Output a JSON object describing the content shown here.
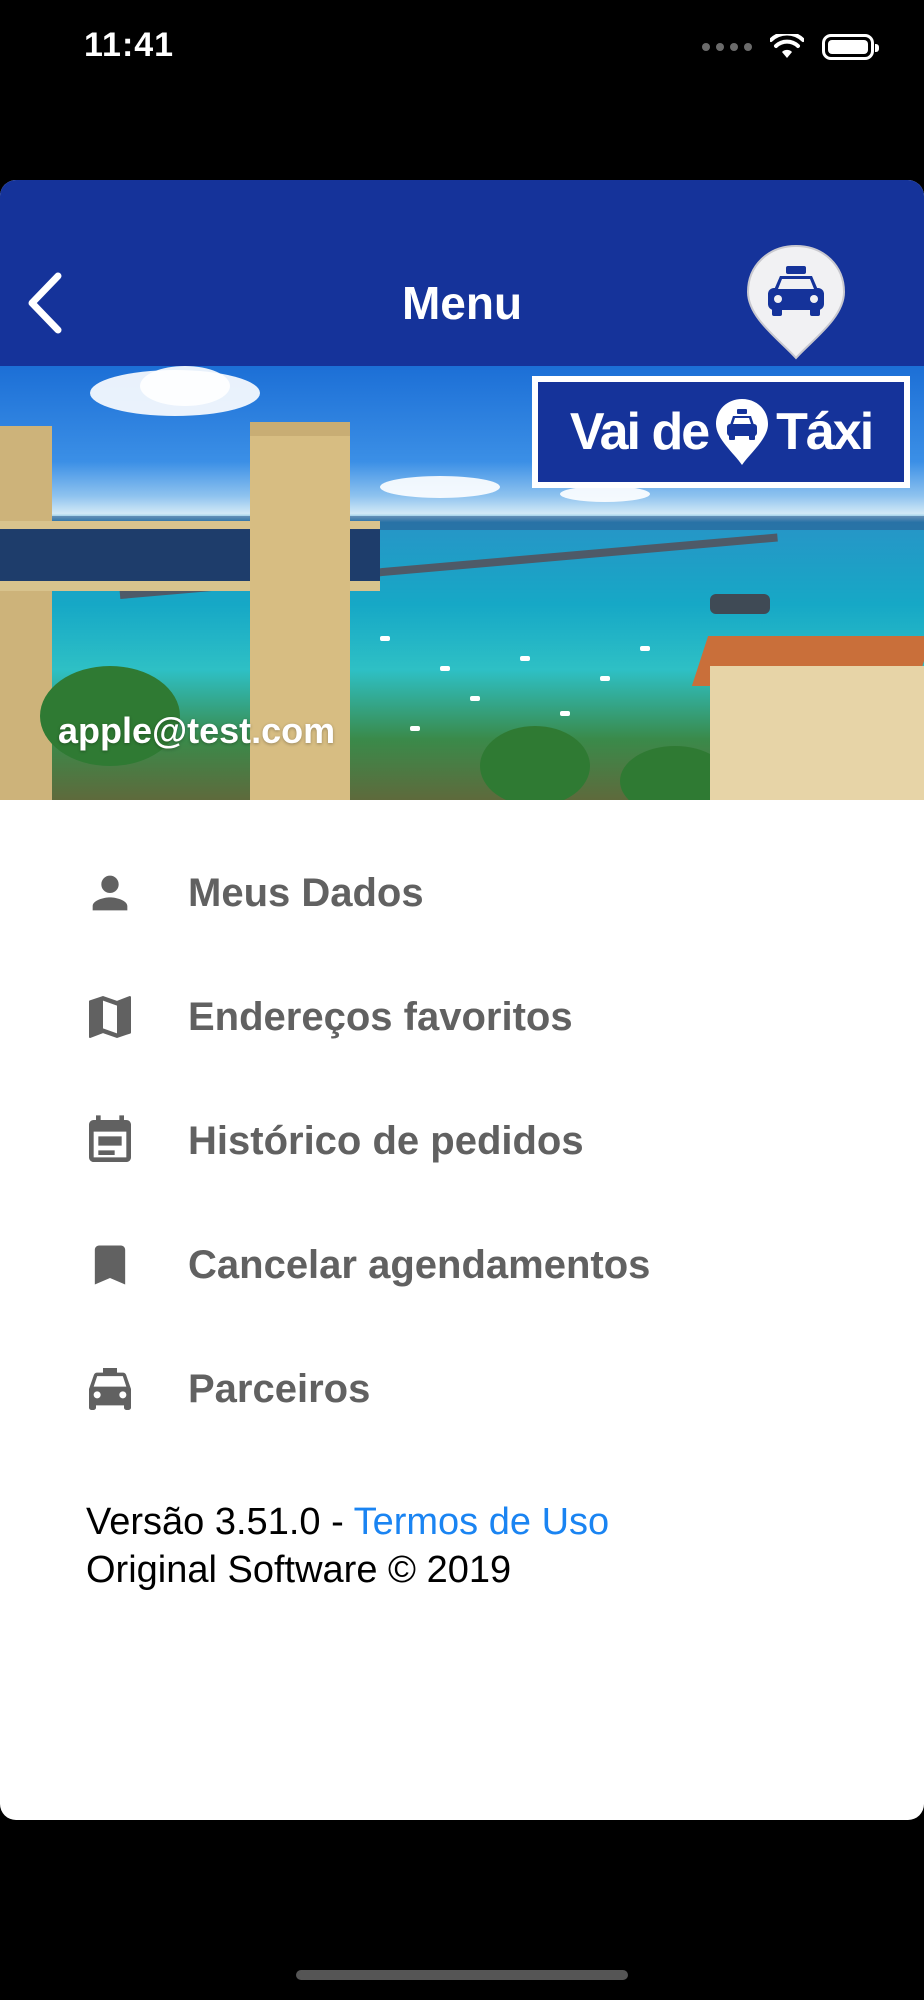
{
  "status_bar": {
    "time": "11:41"
  },
  "header": {
    "title": "Menu"
  },
  "banner": {
    "logo_text_left": "Vai de",
    "logo_text_right": "Táxi",
    "email": "apple@test.com"
  },
  "menu": {
    "items": [
      {
        "label": "Meus Dados",
        "icon": "person-icon"
      },
      {
        "label": "Endereços favoritos",
        "icon": "map-icon"
      },
      {
        "label": "Histórico de pedidos",
        "icon": "calendar-icon"
      },
      {
        "label": "Cancelar agendamentos",
        "icon": "bookmark-icon"
      },
      {
        "label": "Parceiros",
        "icon": "taxi-icon"
      }
    ]
  },
  "footer": {
    "version_text": "Versão 3.51.0 - ",
    "terms_label": "Termos de Uso",
    "copyright": "Original Software © 2019"
  },
  "colors": {
    "brand_blue": "#15339a",
    "link_blue": "#1a84f2",
    "menu_text": "#616161"
  }
}
